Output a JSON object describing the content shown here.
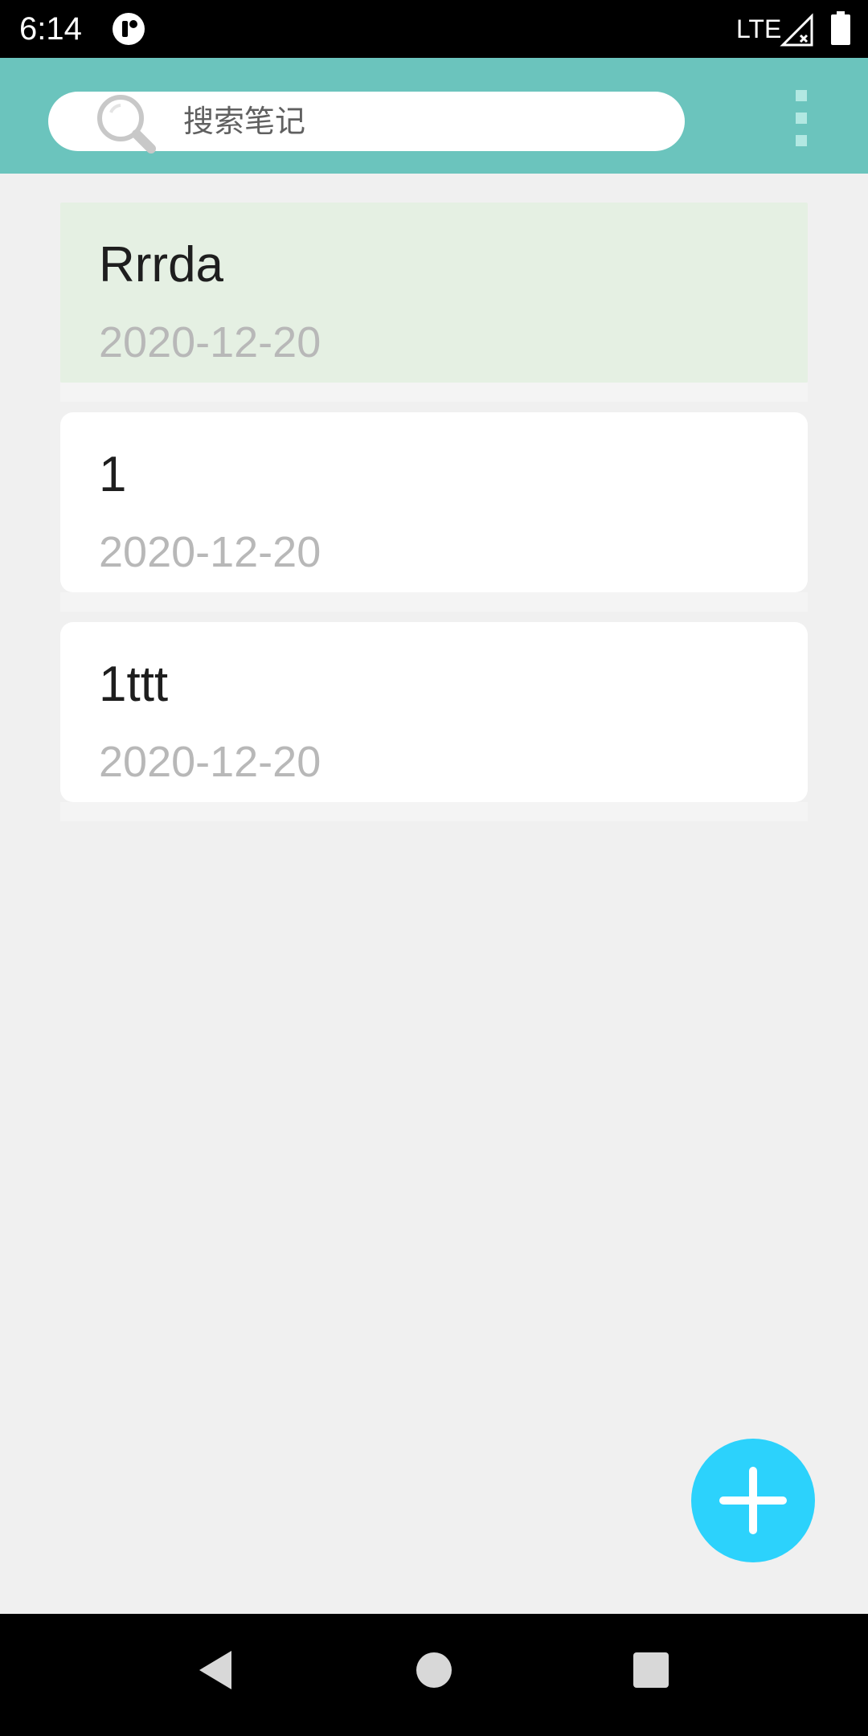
{
  "status_bar": {
    "time": "6:14",
    "network": "LTE",
    "icons": [
      "app-notification-icon",
      "signal-icon",
      "battery-icon"
    ]
  },
  "toolbar": {
    "search": {
      "placeholder": "搜索笔记",
      "icon": "search-icon"
    },
    "more_icon": "more-vert-icon",
    "background_color": "#6bc4bd"
  },
  "notes": [
    {
      "title": "Rrrda",
      "date": "2020-12-20",
      "selected": true
    },
    {
      "title": "1",
      "date": "2020-12-20",
      "selected": false
    },
    {
      "title": "1ttt",
      "date": "2020-12-20",
      "selected": false
    }
  ],
  "fab": {
    "icon": "plus-icon",
    "color": "#2cd2fc"
  },
  "nav_bar": {
    "icons": [
      "back-icon",
      "home-icon",
      "recents-icon"
    ]
  },
  "colors": {
    "selected_card": "#e5f0e3",
    "date_text": "#b8b8b8"
  }
}
